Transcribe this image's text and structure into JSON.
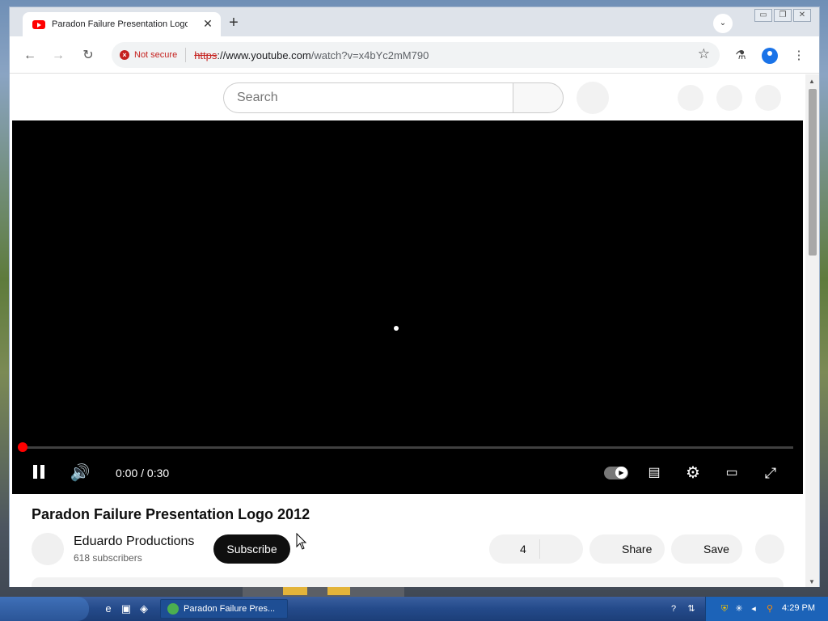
{
  "browser": {
    "tab_title": "Paradon Failure Presentation Logo",
    "tab_close": "✕",
    "new_tab": "+",
    "security_label": "Not secure",
    "url_scheme": "https",
    "url_host": "://www.youtube.com",
    "url_path": "/watch?v=x4bYc2mM790"
  },
  "youtube": {
    "search_placeholder": "Search"
  },
  "player": {
    "time": "0:00 / 0:30",
    "progress_fraction": 0.0
  },
  "video": {
    "title": "Paradon Failure Presentation Logo 2012",
    "channel_name": "Eduardo Productions",
    "subscribers": "618 subscribers",
    "subscribe_label": "Subscribe",
    "like_count": "4",
    "share_label": "Share",
    "save_label": "Save"
  },
  "taskbar": {
    "task_label": "Paradon Failure Pres...",
    "clock": "4:29 PM"
  },
  "icons": {
    "back": "back-arrow-icon",
    "forward": "forward-arrow-icon",
    "reload": "reload-icon",
    "star": "bookmark-star-icon",
    "labs": "labs-flask-icon",
    "profile": "profile-icon",
    "menu": "kebab-menu-icon"
  },
  "colors": {
    "youtube_red": "#ff0000",
    "not_secure_red": "#c5221f",
    "subscribe_bg": "#0f0f0f"
  }
}
